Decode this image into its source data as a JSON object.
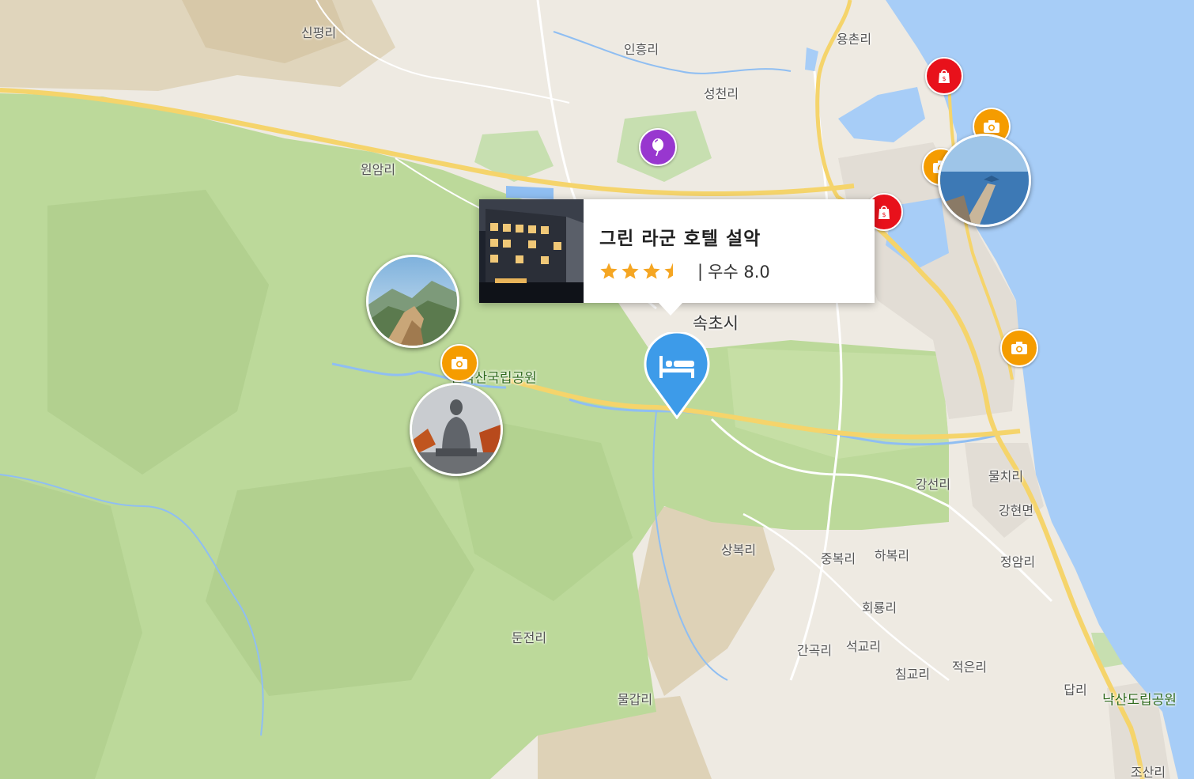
{
  "map": {
    "places": [
      {
        "id": "sinpyeong",
        "label": "신평리"
      },
      {
        "id": "inheung",
        "label": "인흥리"
      },
      {
        "id": "yongchon",
        "label": "용촌리"
      },
      {
        "id": "seongcheon",
        "label": "성천리"
      },
      {
        "id": "wonam",
        "label": "원암리"
      },
      {
        "id": "sokcho",
        "label": "속초시"
      },
      {
        "id": "seorak_park",
        "label": "설악산국립공원"
      },
      {
        "id": "gangseon",
        "label": "강선리"
      },
      {
        "id": "mulchi",
        "label": "물치리"
      },
      {
        "id": "ganghyeon",
        "label": "강현면"
      },
      {
        "id": "sangbok",
        "label": "상복리"
      },
      {
        "id": "jungbok",
        "label": "중복리"
      },
      {
        "id": "habok",
        "label": "하복리"
      },
      {
        "id": "jeongam",
        "label": "정암리"
      },
      {
        "id": "hoeryong",
        "label": "회룡리"
      },
      {
        "id": "dunjeon",
        "label": "둔전리"
      },
      {
        "id": "gangok",
        "label": "간곡리"
      },
      {
        "id": "seokgyo",
        "label": "석교리"
      },
      {
        "id": "chimgyo",
        "label": "침교리"
      },
      {
        "id": "jeogeun",
        "label": "적은리"
      },
      {
        "id": "dap",
        "label": "답리"
      },
      {
        "id": "naksan_park",
        "label": "낙산도립공원"
      },
      {
        "id": "mulgap",
        "label": "물갑리"
      },
      {
        "id": "josan",
        "label": "조산리"
      }
    ],
    "colors": {
      "hotel_pin": "#3d9be9",
      "shopping_pin": "#e8111b",
      "camera_pin": "#f59c00",
      "landmark_pin": "#9837cf",
      "star": "#f5a623",
      "sea": "#a7cdf7",
      "park": "#bcd99a"
    }
  },
  "hotel_popup": {
    "name": "그린 라군 호텔 설악",
    "rating_stars": 3.5,
    "rating_label": "우수 8.0",
    "separator": "|"
  }
}
